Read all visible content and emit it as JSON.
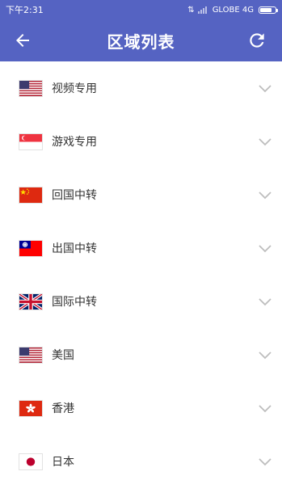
{
  "status_bar": {
    "time": "下午2:31",
    "signal_text": "⇅",
    "carrier": "GLOBE 4G",
    "battery_level": 0.8
  },
  "header": {
    "title": "区域列表",
    "back_icon": "arrow-left-icon",
    "refresh_icon": "refresh-icon"
  },
  "colors": {
    "primary": "#5563c2",
    "text": "#333333",
    "chevron": "#bdbdbd"
  },
  "regions": [
    {
      "label": "视频专用",
      "flag": "us-flag-icon"
    },
    {
      "label": "游戏专用",
      "flag": "singapore-flag-icon"
    },
    {
      "label": "回国中转",
      "flag": "china-flag-icon"
    },
    {
      "label": "出国中转",
      "flag": "taiwan-flag-icon"
    },
    {
      "label": "国际中转",
      "flag": "uk-flag-icon"
    },
    {
      "label": "美国",
      "flag": "us-flag-icon"
    },
    {
      "label": "香港",
      "flag": "hong-kong-flag-icon"
    },
    {
      "label": "日本",
      "flag": "japan-flag-icon"
    }
  ]
}
